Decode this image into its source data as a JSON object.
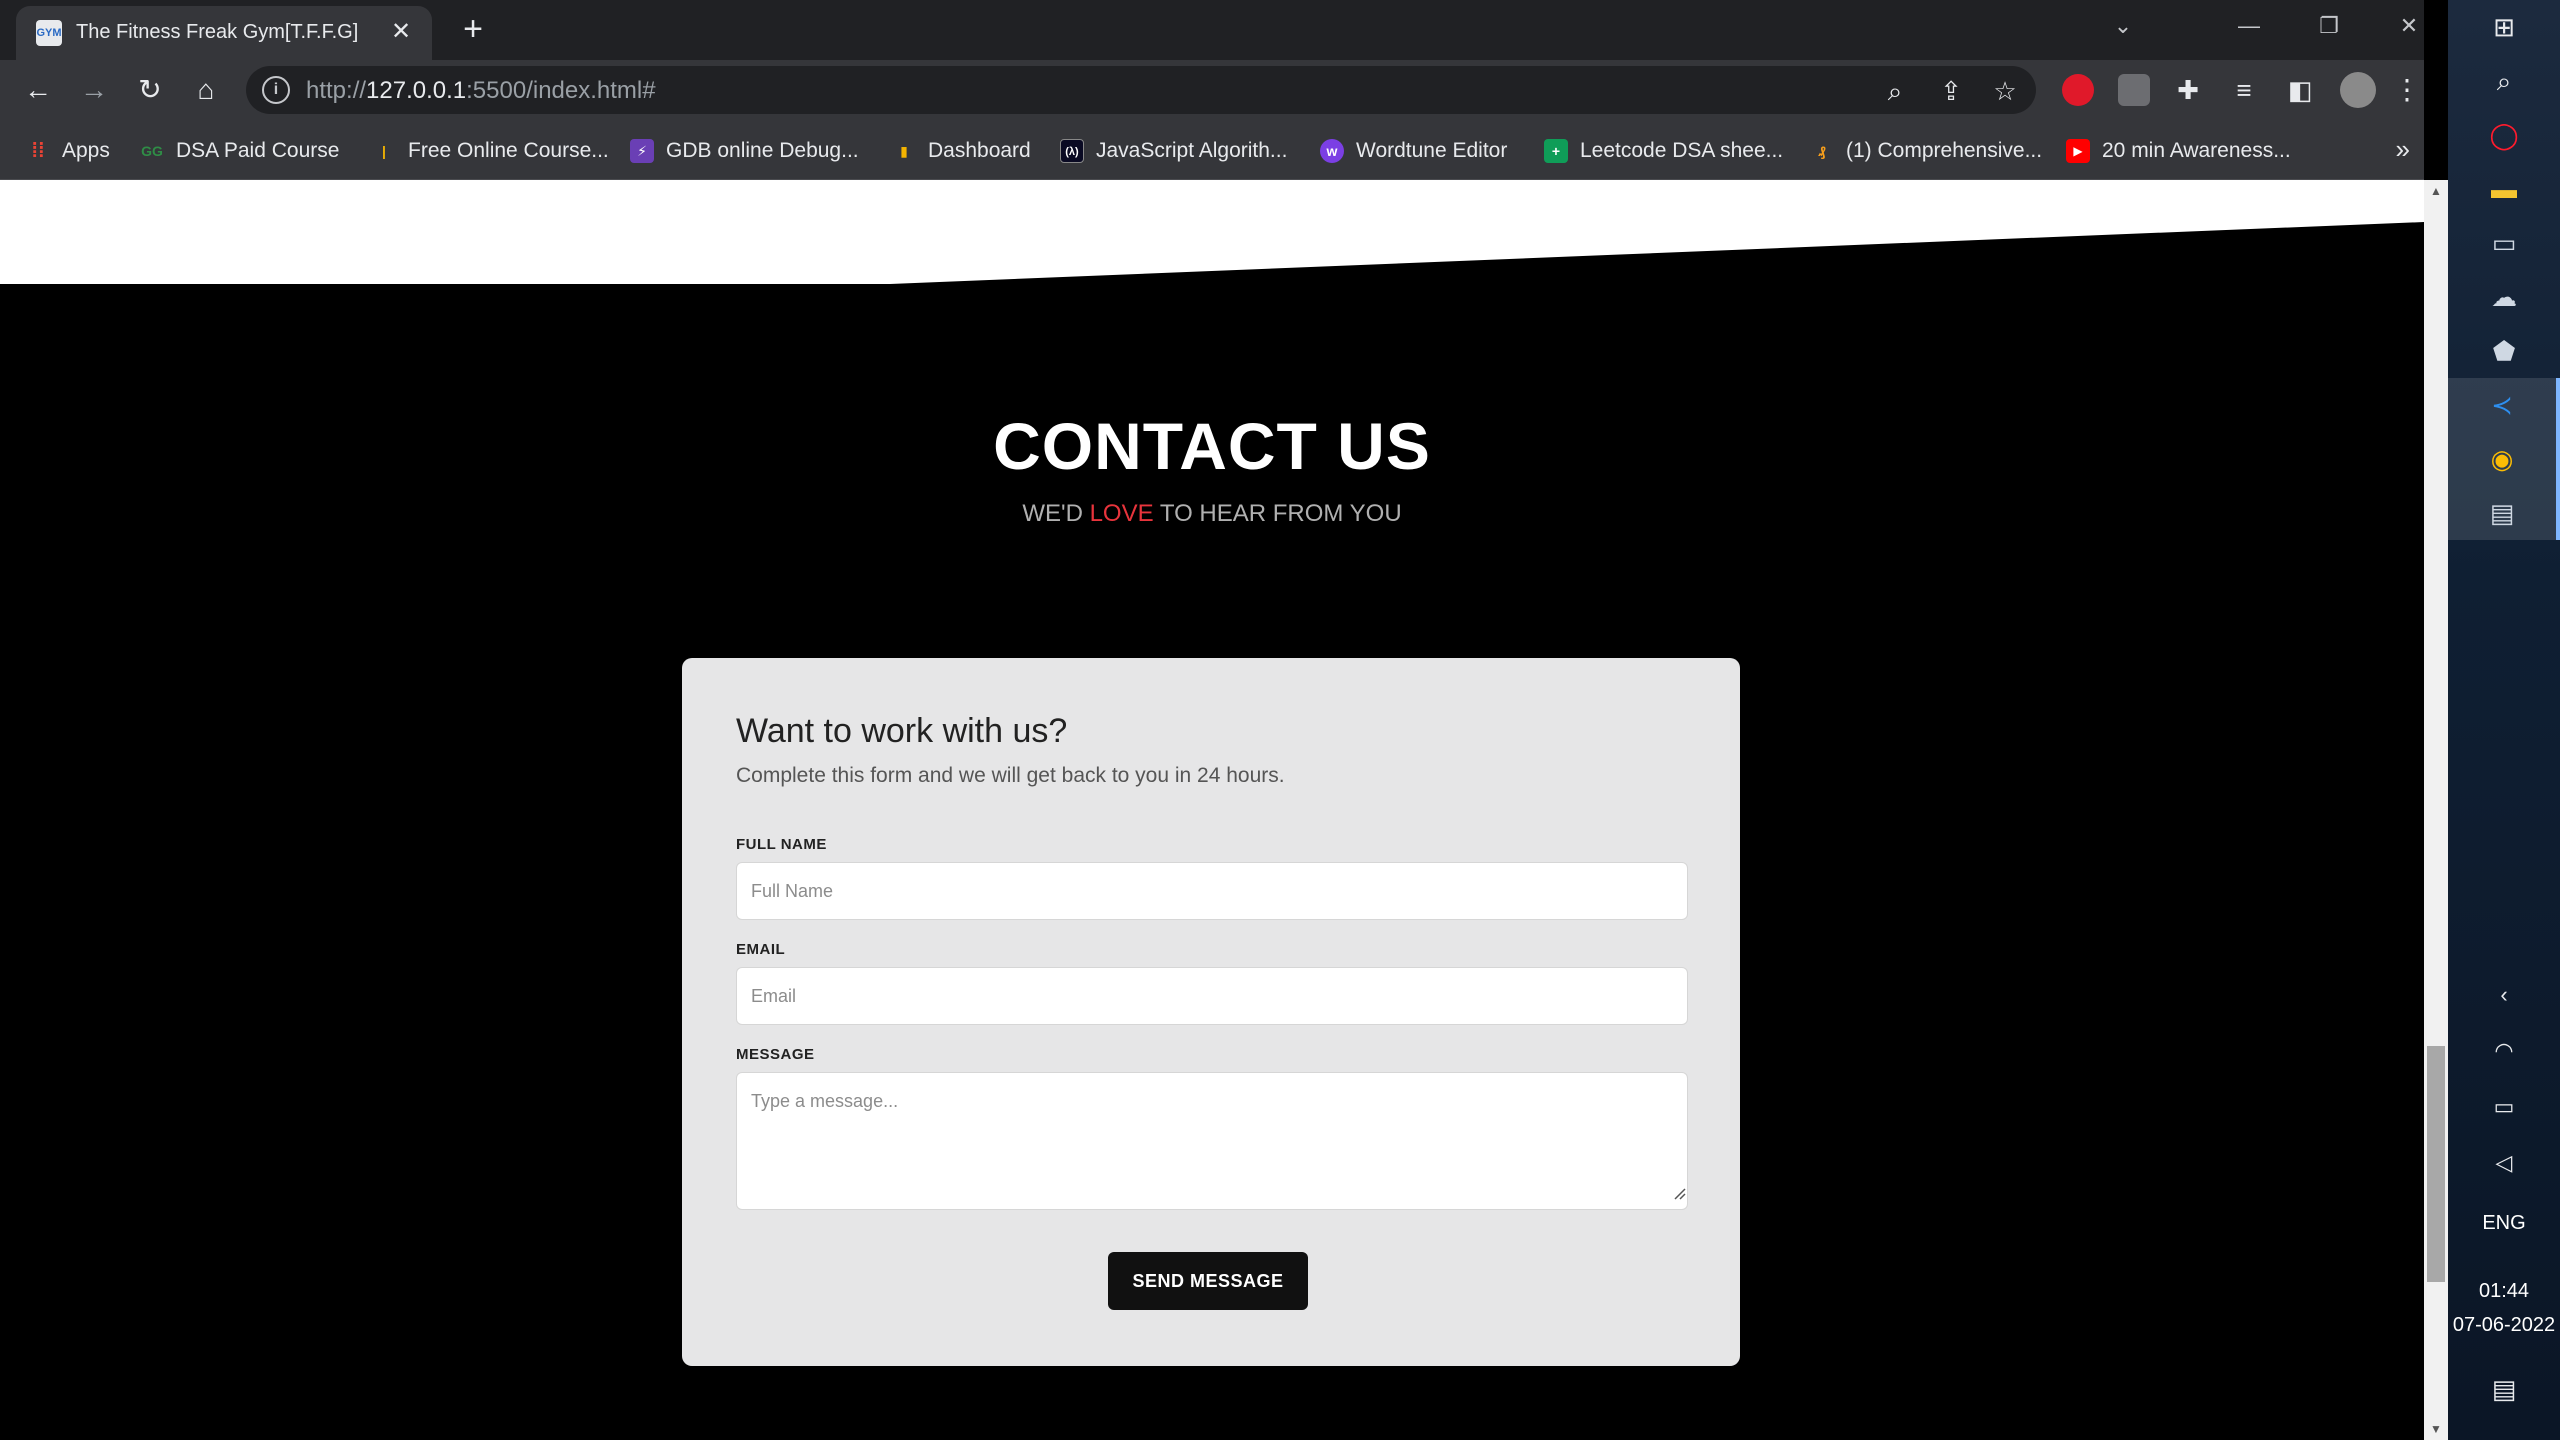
{
  "browser": {
    "tab": {
      "title": "The Fitness Freak Gym[T.F.F.G]",
      "favicon_text": "GYM",
      "close_icon": "close-icon"
    },
    "new_tab_icon": "plus-icon",
    "window_controls": [
      "chevron-down-icon",
      "minimize-icon",
      "restore-icon",
      "close-icon"
    ],
    "toolbar_icons": [
      "back-arrow-icon",
      "forward-arrow-icon",
      "reload-icon",
      "home-icon"
    ],
    "url": {
      "scheme": "http://",
      "host": "127.0.0.1",
      "rest": ":5500/index.html#"
    },
    "omnibox_icons": [
      "zoom-icon",
      "share-icon",
      "star-icon"
    ],
    "extensions": [
      "adblock-icon",
      "clipboard-extension-icon",
      "puzzle-icon",
      "media-queue-icon",
      "side-panel-icon",
      "profile-avatar",
      "kebab-menu-icon"
    ],
    "bookmarks": [
      {
        "label": "Apps",
        "icon": "apps-grid-icon",
        "color": "#ea4335"
      },
      {
        "label": "DSA Paid Course",
        "icon": "gfg-icon",
        "color": "#2f8d46"
      },
      {
        "label": "Free Online Course...",
        "icon": "bar-icon",
        "color": "#f4b400"
      },
      {
        "label": "GDB online Debug...",
        "icon": "lightning-icon",
        "color": "#6a3fb5"
      },
      {
        "label": "Dashboard",
        "icon": "bar-chart-icon",
        "color": "#f4b400"
      },
      {
        "label": "JavaScript Algorith...",
        "icon": "fcc-icon",
        "color": "#0a0a23"
      },
      {
        "label": "Wordtune Editor",
        "icon": "wordtune-icon",
        "color": "#7b3fe4"
      },
      {
        "label": "Leetcode DSA shee...",
        "icon": "sheets-icon",
        "color": "#0f9d58"
      },
      {
        "label": "(1) Comprehensive...",
        "icon": "leetcode-icon",
        "color": "#f89f1b"
      },
      {
        "label": "20 min Awareness...",
        "icon": "youtube-icon",
        "color": "#ff0000"
      }
    ],
    "bookmarks_more": "»"
  },
  "page": {
    "section_title": "CONTACT US",
    "subtitle": {
      "before": "WE'D ",
      "accent": "LOVE",
      "after": " TO HEAR FROM YOU"
    },
    "form": {
      "heading": "Want to work with us?",
      "description": "Complete this form and we will get back to you in 24 hours.",
      "full_name": {
        "label": "FULL NAME",
        "placeholder": "Full Name",
        "value": ""
      },
      "email": {
        "label": "EMAIL",
        "placeholder": "Email",
        "value": ""
      },
      "message": {
        "label": "MESSAGE",
        "placeholder": "Type a message...",
        "value": ""
      },
      "submit_label": "SEND MESSAGE"
    },
    "colors": {
      "accent": "#e8343c",
      "card": "#e6e6e7",
      "button": "#111111",
      "background": "#000000"
    }
  },
  "scrollbar": {
    "position_fraction": 0.86
  },
  "taskbar": {
    "icons": [
      "windows-start-icon",
      "search-icon",
      "opera-icon",
      "file-explorer-icon",
      "monitor-icon",
      "cloud-icon",
      "shield-icon",
      "vscode-icon",
      "chrome-icon",
      "terminal-icon"
    ],
    "tray_icons": [
      "chevron-left-icon",
      "wifi-icon",
      "battery-icon",
      "volume-icon"
    ],
    "language": "ENG",
    "time": "01:44",
    "date": "07-06-2022",
    "notification_icon": "notification-icon"
  }
}
